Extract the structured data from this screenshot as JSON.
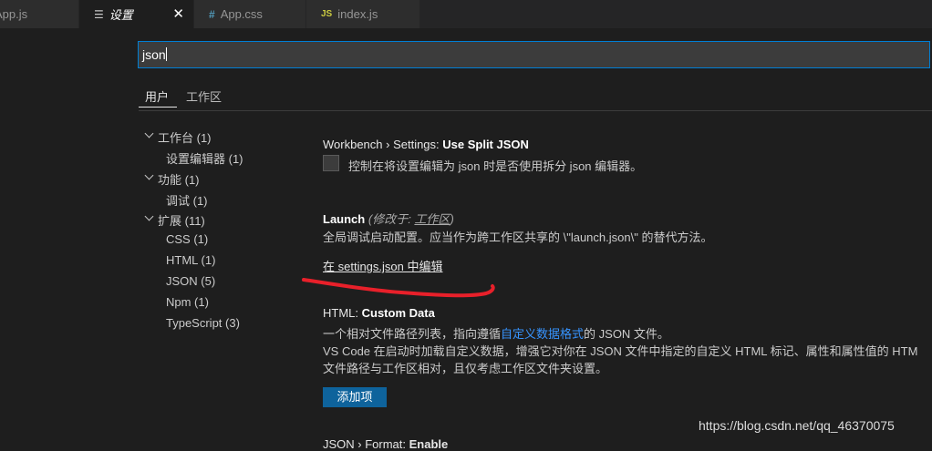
{
  "tabs": [
    {
      "label": "App.js",
      "icon": "js-file-icon"
    },
    {
      "label": "设置",
      "icon": "settings-file-icon",
      "close": "✕"
    },
    {
      "label": "App.css",
      "icon": "css-file-icon",
      "glyph": "#"
    },
    {
      "label": "index.js",
      "icon": "js-file-icon",
      "glyph": "JS"
    }
  ],
  "search": {
    "value": "json"
  },
  "scope_tabs": [
    "用户",
    "工作区"
  ],
  "toc": {
    "workbench": "工作台 (1)",
    "settings_editor": "设置编辑器 (1)",
    "features": "功能 (1)",
    "debug": "调试 (1)",
    "extensions": "扩展 (11)",
    "ext_items": [
      "CSS (1)",
      "HTML (1)",
      "JSON (5)",
      "Npm (1)",
      "TypeScript (3)"
    ]
  },
  "settings": {
    "split_json": {
      "category": "Workbench › Settings: ",
      "name": "Use Split JSON",
      "desc": "控制在将设置编辑为 json 时是否使用拆分 json 编辑器。"
    },
    "launch": {
      "name": "Launch",
      "modified_prefix": "(修改于: ",
      "modified_scope": "工作区",
      "modified_suffix": ")",
      "desc": "全局调试启动配置。应当作为跨工作区共享的 \\\"launch.json\\\" 的替代方法。",
      "edit_link": "在 settings.json 中编辑"
    },
    "html_data": {
      "category": "HTML: ",
      "name": "Custom Data",
      "desc1_pre": "一个相对文件路径列表，指向遵循",
      "desc1_link": "自定义数据格式",
      "desc1_post": "的 JSON 文件。",
      "desc2": "VS Code 在启动时加载自定义数据，增强它对你在 JSON 文件中指定的自定义 HTML 标记、属性和属性值的 HTM",
      "desc3": "文件路径与工作区相对，且仅考虑工作区文件夹设置。",
      "add_button": "添加项"
    },
    "json_format": {
      "category": "JSON › Format: ",
      "name": "Enable"
    }
  },
  "watermark": "https://blog.csdn.net/qq_46370075",
  "colors": {
    "accent": "#007fd4",
    "link": "#3794ff",
    "button": "#0e639c",
    "annotation": "#e8202a"
  }
}
